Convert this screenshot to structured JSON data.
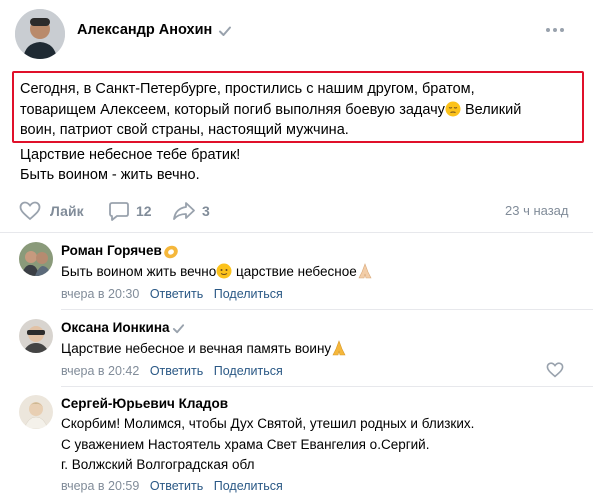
{
  "post": {
    "author": "Александр Анохин",
    "text_lines": [
      "Сегодня, в Санкт-Петербурге, простились с нашим другом, братом,",
      "товарищем Алексеем, который погиб выполняя боевую задачу",
      "воин, патриот свой страны, настоящий мужчина.",
      "Царствие небесное тебе братик!",
      "Быть воином - жить вечно."
    ],
    "text_line2_tail": " Великий",
    "actions": {
      "like_label": "Лайк",
      "comments_count": "12",
      "shares_count": "3",
      "time": "23 ч назад"
    }
  },
  "comments": [
    {
      "author": "Роман Горячев",
      "text": "Быть воином жить вечно",
      "text_tail": " царствие небесное",
      "time": "вчера в 20:30",
      "reply_label": "Ответить",
      "share_label": "Поделиться"
    },
    {
      "author": "Оксана Ионкина",
      "text": "Царствие небесное и вечная память воину",
      "time": "вчера в 20:42",
      "reply_label": "Ответить",
      "share_label": "Поделиться"
    },
    {
      "author": "Сергей-Юрьевич Кладов",
      "text_lines": [
        "Скорбим! Молимся, чтобы Дух Святой, утешил родных и близких.",
        "С уважением Настоятель храма Свет Евангелия о.Сергий.",
        "г. Волжский Волгоградская обл"
      ],
      "time": "вчера в 20:59",
      "reply_label": "Ответить",
      "share_label": "Поделиться"
    }
  ],
  "colors": {
    "link": "#2a5885",
    "muted": "#818c99",
    "highlight": "#e0102a"
  }
}
